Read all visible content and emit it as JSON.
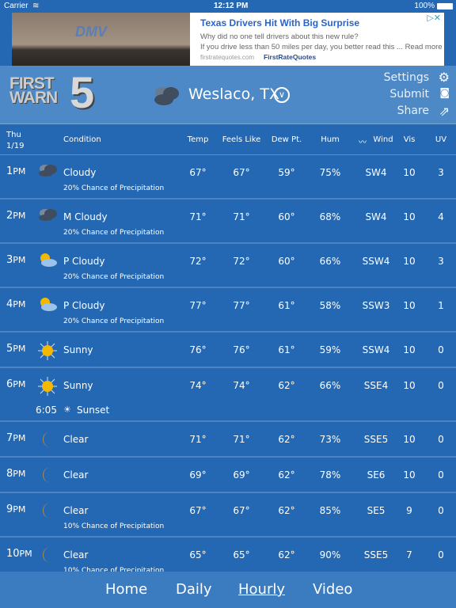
{
  "status": {
    "carrier": "Carrier",
    "time": "12:12 PM",
    "battery": "100%"
  },
  "ad": {
    "image_text": "DMV",
    "title": "Texas Drivers Hit With Big Surprise",
    "line1": "Why did no one tell drivers about this new rule?",
    "line2": "If you drive less than 50 miles per day, you better read this ... Read more",
    "source": "firstratequotes.com",
    "brand": "FirstRateQuotes"
  },
  "header": {
    "logo_line1": "FIRST",
    "logo_line2": "WARN",
    "logo_num": "5",
    "location": "Weslaco, TX",
    "settings": "Settings",
    "submit": "Submit",
    "share": "Share"
  },
  "columns": {
    "day": "Thu",
    "date": "1/19",
    "condition": "Condition",
    "temp": "Temp",
    "feels": "Feels Like",
    "dew": "Dew Pt.",
    "hum": "Hum",
    "wind": "Wind",
    "vis": "Vis",
    "uv": "UV"
  },
  "rows": [
    {
      "hour": "1",
      "ampm": "PM",
      "icon": "cloudy",
      "condition": "Cloudy",
      "precip": "20% Chance of Precipitation",
      "temp": "67°",
      "feels": "67°",
      "dew": "59°",
      "hum": "75%",
      "wind": "SW4",
      "vis": "10",
      "uv": "3"
    },
    {
      "hour": "2",
      "ampm": "PM",
      "icon": "cloudy",
      "condition": "M Cloudy",
      "precip": "20% Chance of Precipitation",
      "temp": "71°",
      "feels": "71°",
      "dew": "60°",
      "hum": "68%",
      "wind": "SW4",
      "vis": "10",
      "uv": "4"
    },
    {
      "hour": "3",
      "ampm": "PM",
      "icon": "partly-cloudy",
      "condition": "P Cloudy",
      "precip": "20% Chance of Precipitation",
      "temp": "72°",
      "feels": "72°",
      "dew": "60°",
      "hum": "66%",
      "wind": "SSW4",
      "vis": "10",
      "uv": "3"
    },
    {
      "hour": "4",
      "ampm": "PM",
      "icon": "partly-cloudy",
      "condition": "P Cloudy",
      "precip": "20% Chance of Precipitation",
      "temp": "77°",
      "feels": "77°",
      "dew": "61°",
      "hum": "58%",
      "wind": "SSW3",
      "vis": "10",
      "uv": "1"
    },
    {
      "hour": "5",
      "ampm": "PM",
      "icon": "sunny",
      "condition": "Sunny",
      "temp": "76°",
      "feels": "76°",
      "dew": "61°",
      "hum": "59%",
      "wind": "SSW4",
      "vis": "10",
      "uv": "0"
    },
    {
      "hour": "6",
      "ampm": "PM",
      "icon": "sunny",
      "condition": "Sunny",
      "sunset_time": "6:05",
      "sunset_label": "Sunset",
      "temp": "74°",
      "feels": "74°",
      "dew": "62°",
      "hum": "66%",
      "wind": "SSE4",
      "vis": "10",
      "uv": "0"
    },
    {
      "hour": "7",
      "ampm": "PM",
      "icon": "moon",
      "condition": "Clear",
      "temp": "71°",
      "feels": "71°",
      "dew": "62°",
      "hum": "73%",
      "wind": "SSE5",
      "vis": "10",
      "uv": "0"
    },
    {
      "hour": "8",
      "ampm": "PM",
      "icon": "moon",
      "condition": "Clear",
      "temp": "69°",
      "feels": "69°",
      "dew": "62°",
      "hum": "78%",
      "wind": "SE6",
      "vis": "10",
      "uv": "0"
    },
    {
      "hour": "9",
      "ampm": "PM",
      "icon": "moon",
      "condition": "Clear",
      "precip": "10% Chance of Precipitation",
      "temp": "67°",
      "feels": "67°",
      "dew": "62°",
      "hum": "85%",
      "wind": "SE5",
      "vis": "9",
      "uv": "0"
    },
    {
      "hour": "10",
      "ampm": "PM",
      "icon": "moon",
      "condition": "Clear",
      "precip": "10% Chance of Precipitation",
      "temp": "65°",
      "feels": "65°",
      "dew": "62°",
      "hum": "90%",
      "wind": "SSE5",
      "vis": "7",
      "uv": "0"
    }
  ],
  "nav": {
    "home": "Home",
    "daily": "Daily",
    "hourly": "Hourly",
    "video": "Video",
    "active": "Hourly"
  },
  "colors": {
    "background": "#2468b3",
    "header": "#4d89c6",
    "footer": "#3b7cc1",
    "sun": "#f5b800",
    "moon": "#a8884a"
  }
}
